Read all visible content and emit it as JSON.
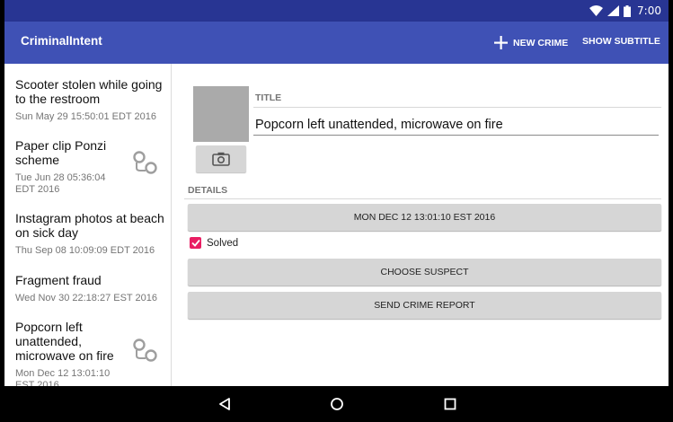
{
  "status_bar": {
    "time": "7:00",
    "icons": [
      "wifi-icon",
      "signal-icon",
      "battery-icon"
    ]
  },
  "toolbar": {
    "title": "CriminalIntent",
    "new_crime_label": "NEW CRIME",
    "show_subtitle_label": "SHOW SUBTITLE"
  },
  "crimes": [
    {
      "title": "Scooter stolen while going to the restroom",
      "date": "Sun May 29 15:50:01 EDT 2016",
      "solved": false
    },
    {
      "title": "Paper clip Ponzi scheme",
      "date": "Tue Jun 28 05:36:04 EDT 2016",
      "solved": true
    },
    {
      "title": "Instagram photos at beach on sick day",
      "date": "Thu Sep 08 10:09:09 EDT 2016",
      "solved": false
    },
    {
      "title": "Fragment fraud",
      "date": "Wed Nov 30 22:18:27 EST 2016",
      "solved": false
    },
    {
      "title": "Popcorn left unattended, microwave on fire",
      "date": "Mon Dec 12 13:01:10 EST 2016",
      "solved": true
    }
  ],
  "detail": {
    "title_label": "TITLE",
    "title_value": "Popcorn left unattended, microwave on fire",
    "details_label": "DETAILS",
    "date_button": "MON DEC 12 13:01:10 EST 2016",
    "solved_label": "Solved",
    "solved": true,
    "choose_suspect_button": "CHOOSE SUSPECT",
    "send_report_button": "SEND CRIME REPORT"
  },
  "colors": {
    "status_bar": "#283593",
    "toolbar": "#3f51b5",
    "accent": "#e91e63"
  }
}
